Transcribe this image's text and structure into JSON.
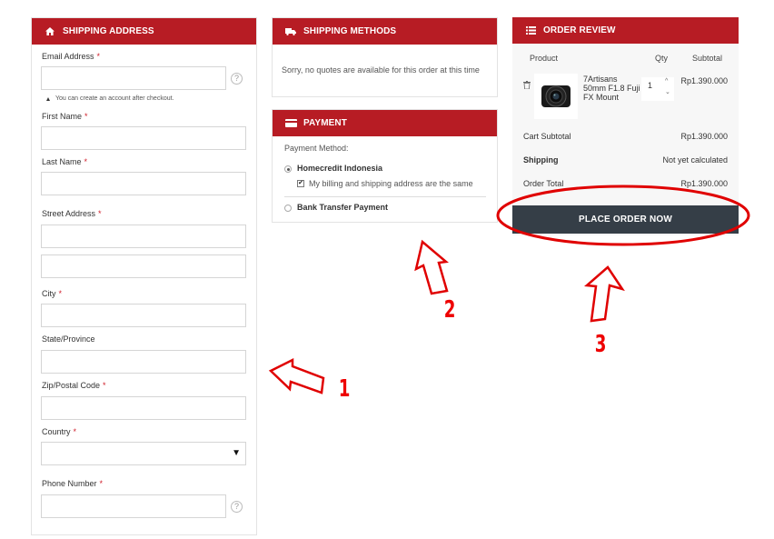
{
  "shipping_address": {
    "title": "SHIPPING ADDRESS",
    "icon": "home-icon",
    "email_label": "Email Address",
    "email_hint": "You can create an account after checkout.",
    "first_name_label": "First Name",
    "last_name_label": "Last Name",
    "street_label": "Street Address",
    "city_label": "City",
    "state_label": "State/Province",
    "zip_label": "Zip/Postal Code",
    "country_label": "Country",
    "country_value": "",
    "phone_label": "Phone Number",
    "required_mark": "*",
    "help_glyph": "?"
  },
  "shipping_methods": {
    "title": "SHIPPING METHODS",
    "icon": "truck-icon",
    "message": "Sorry, no quotes are available for this order at this time"
  },
  "payment": {
    "title": "PAYMENT",
    "icon": "credit-card-icon",
    "method_label": "Payment Method:",
    "options": [
      {
        "label": "Homecredit Indonesia",
        "selected": true
      },
      {
        "label": "Bank Transfer Payment",
        "selected": false
      }
    ],
    "billing_same_label": "My billing and shipping address are the same",
    "billing_same_checked": true
  },
  "order_review": {
    "title": "ORDER REVIEW",
    "icon": "list-icon",
    "col_product": "Product",
    "col_qty": "Qty",
    "col_subtotal": "Subtotal",
    "item": {
      "name": "7Artisans 50mm F1.8 Fuji FX Mount",
      "qty": "1",
      "price": "Rp1.390.000"
    },
    "cart_subtotal_label": "Cart Subtotal",
    "cart_subtotal_value": "Rp1.390.000",
    "shipping_label": "Shipping",
    "shipping_value": "Not yet calculated",
    "order_total_label": "Order Total",
    "order_total_value": "Rp1.390.000",
    "place_order_label": "PLACE ORDER NOW"
  },
  "annotations": {
    "step1": "1",
    "step2": "2",
    "step3": "3",
    "color": "#e00000"
  },
  "colors": {
    "header_red": "#b71c24",
    "button_dark": "#353e47",
    "required_red": "#d0202c"
  }
}
